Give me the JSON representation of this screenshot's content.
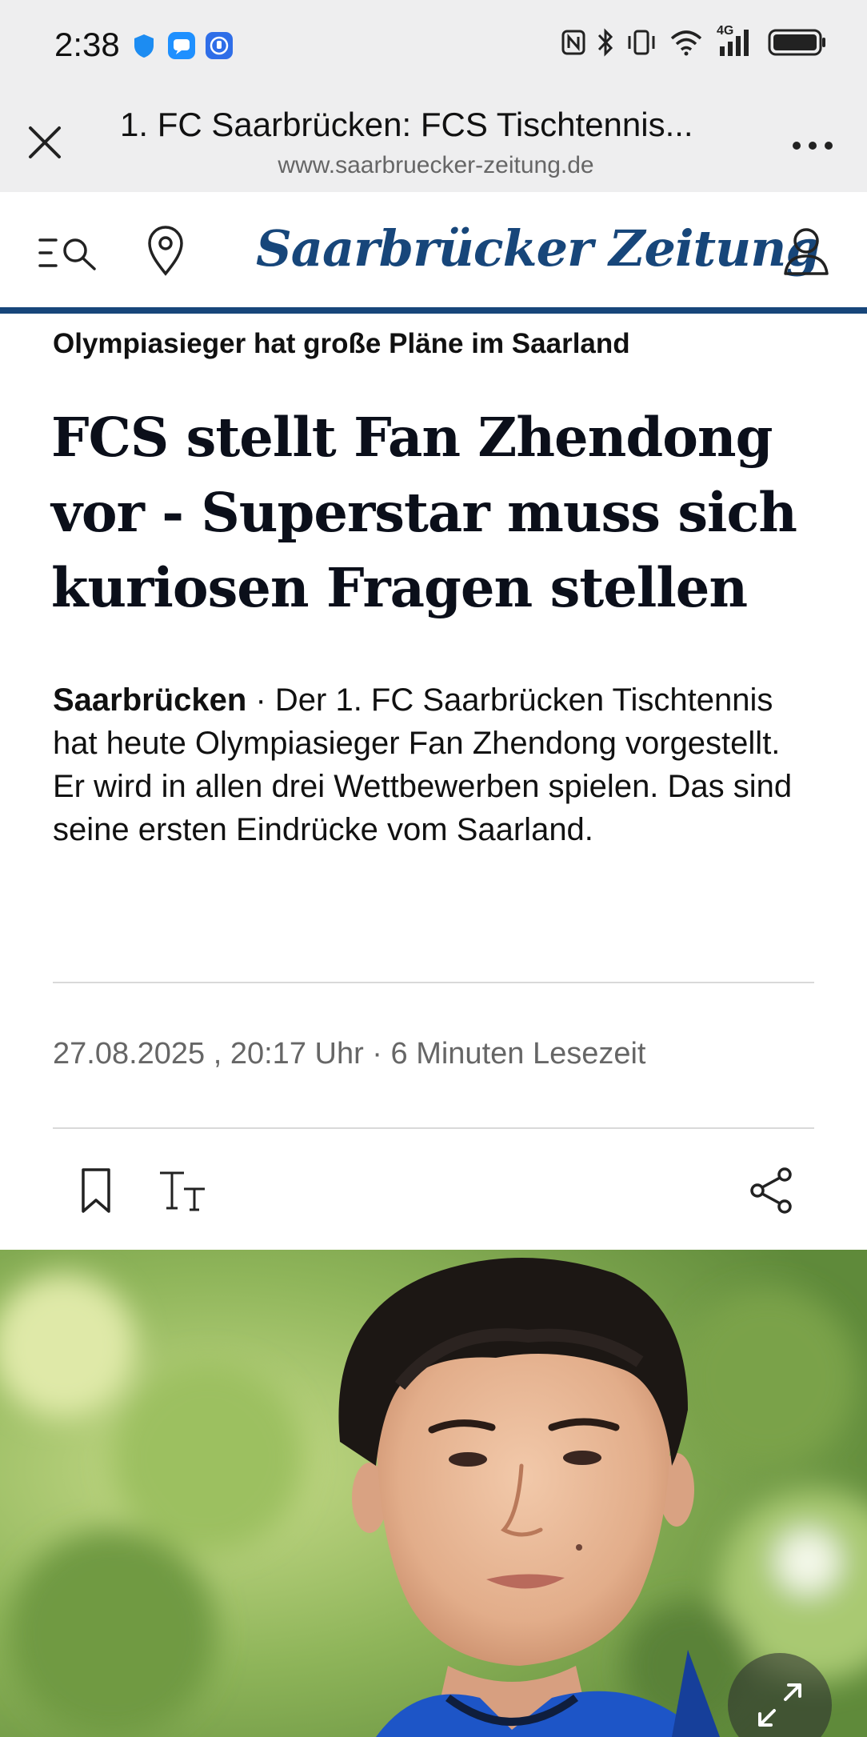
{
  "status_bar": {
    "time": "2:38",
    "network": "4G"
  },
  "browser": {
    "title": "1. FC Saarbrücken: FCS Tischtennis...",
    "url": "www.saarbruecker-zeitung.de"
  },
  "site": {
    "logo_text": "Saarbrücker Zeitung",
    "brand_color": "#17467a"
  },
  "article": {
    "kicker": "Olympiasieger hat große Pläne im Saarland",
    "headline": "FCS stellt Fan Zhendong vor - Superstar muss sich kuriosen Fragen stellen",
    "lead_place": "Saarbrücken",
    "lead_text": " · Der 1. FC Saarbrücken Tischtennis hat heute Olympiasieger Fan Zhendong vorgestellt. Er wird in allen drei Wettbewerben spielen. Das sind seine ersten Eindrücke vom Saarland.",
    "meta": "27.08.2025 , 20:17 Uhr · 6 Minuten Lesezeit"
  },
  "icons": {
    "close": "close-icon",
    "more": "more-icon",
    "menu_search": "menu-search-icon",
    "location": "location-pin-icon",
    "account": "user-icon",
    "bookmark": "bookmark-icon",
    "text_size": "text-size-icon",
    "share": "share-icon",
    "expand": "expand-icon"
  }
}
